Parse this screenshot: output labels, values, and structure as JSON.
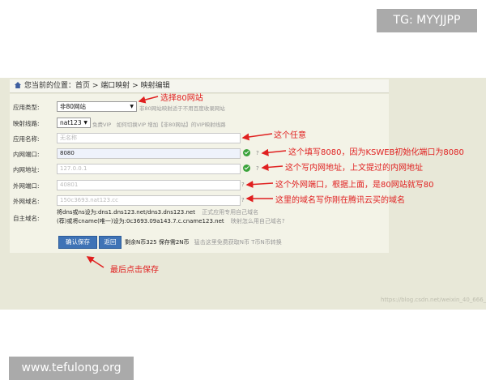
{
  "breadcrumb": {
    "prefix": "您当前的位置：",
    "items": [
      "首页",
      "端口映射",
      "映射编辑"
    ],
    "separator": " > "
  },
  "form": {
    "app_type": {
      "label": "应用类型:",
      "value": "非80网站",
      "hint": "非80网站映射适于不用百度收录网站"
    },
    "line": {
      "label": "映射线路:",
      "value": "nat123",
      "hint": "免费VIP　如何切换VIP 增加【非80网站】的VIP映射线路"
    },
    "app_name": {
      "label": "应用名称:",
      "placeholder": "无名称"
    },
    "internal_port": {
      "label": "内网端口:",
      "value": "8080"
    },
    "internal_addr": {
      "label": "内网地址:",
      "value": "127.0.0.1"
    },
    "external_port": {
      "label": "外网端口:",
      "value": "40801"
    },
    "external_domain": {
      "label": "外网域名:",
      "value": "150c3693.nat123.cc"
    },
    "custom_domain": {
      "label": "自主域名:",
      "line1": "将dns或ns设为:dns1.dns123.net/dns3.dns123.net",
      "line1_hint": "正式应用专用自己域名",
      "line2": "(荐)或将cname(唯一)设为:0c3693.09a143.7.c.cname123.net",
      "line2_hint": "映射怎么用自己域名?"
    },
    "q_mark": "?"
  },
  "buttons": {
    "save": "确认保存",
    "back": "返回",
    "balance_text": "剩余N币325 保存需2N币",
    "balance_hint": "猛击这里免费获取N币 T币N币转换"
  },
  "annotations": {
    "a1": "选择80网站",
    "a2": "这个任意",
    "a3": "这个填写8080，因为KSWEB初始化端口为8080",
    "a4": "这个写内网地址，上文提过的内网地址",
    "a5": "这个外网端口，根据上面，是80网站就写80",
    "a6": "这里的域名写你刚在腾讯云买的域名",
    "a7": "最后点击保存"
  },
  "watermarks": {
    "top": "TG: MYYJJPP",
    "bottom": "www.tefulong.org",
    "csdn": "https://blog.csdn.net/weixin_40_666_"
  },
  "colors": {
    "accent": "#3f73b6",
    "annotation": "#e02020",
    "ok": "#3aa33a"
  }
}
